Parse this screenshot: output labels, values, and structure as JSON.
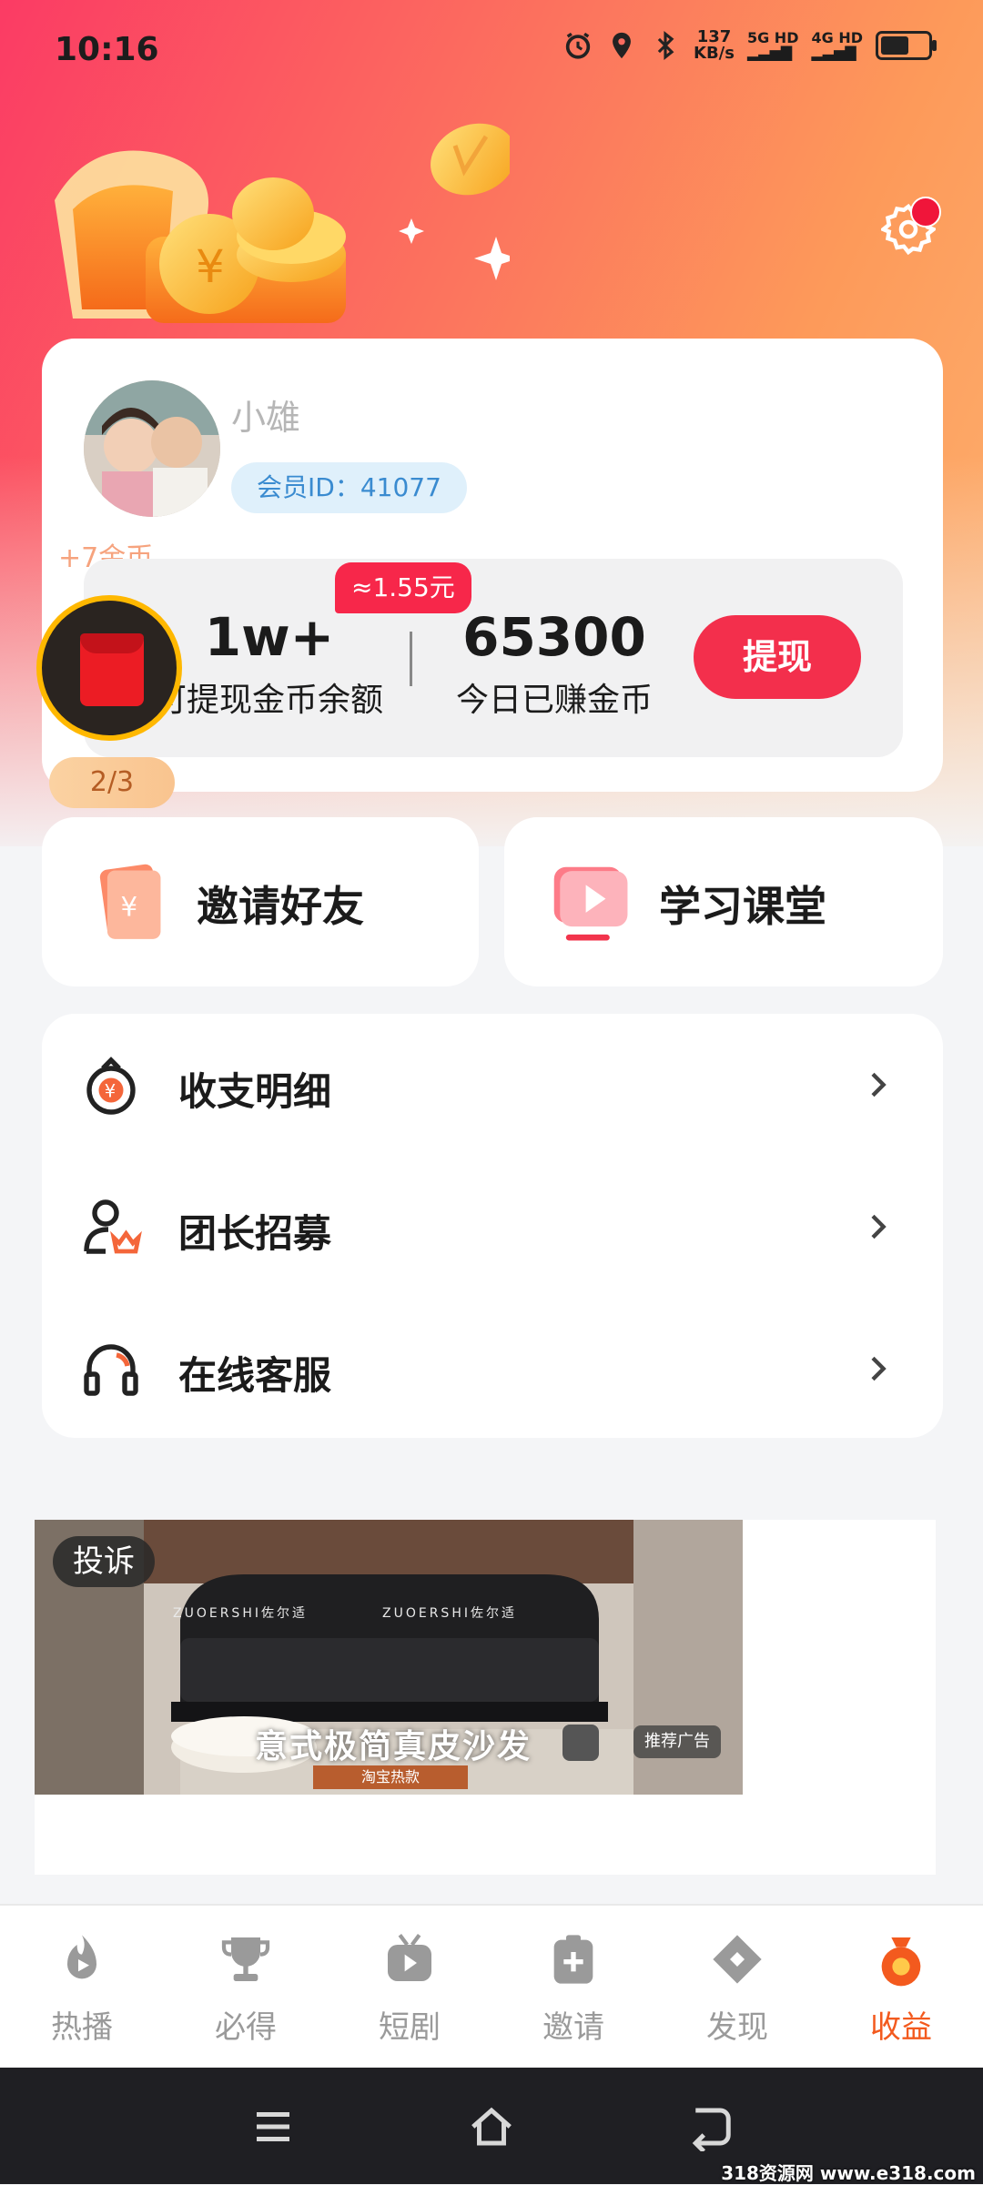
{
  "status_bar": {
    "time": "10:16",
    "net_speed_value": "137",
    "net_speed_unit": "KB/s",
    "sim1": "5G HD",
    "sim2": "4G HD"
  },
  "profile": {
    "username": "小雄",
    "member_id": "会员ID：41077",
    "plus_coins": "+7金币",
    "approx_value": "≈1.55元",
    "balance_value": "1w+",
    "balance_label": "可提现金币余额",
    "today_value": "65300",
    "today_label": "今日已赚金币",
    "withdraw_label": "提现",
    "task_progress": "2/3"
  },
  "quick_actions": [
    {
      "label": "邀请好友"
    },
    {
      "label": "学习课堂"
    }
  ],
  "menu": [
    {
      "label": "收支明细"
    },
    {
      "label": "团长招募"
    },
    {
      "label": "在线客服"
    }
  ],
  "ad": {
    "complain_label": "投诉",
    "caption": "意式极简真皮沙发",
    "sub_caption": "淘宝热款",
    "tag": "推荐广告",
    "brand": "ZUOERSHI佐尔适"
  },
  "bottom_nav": [
    {
      "label": "热播"
    },
    {
      "label": "必得"
    },
    {
      "label": "短剧"
    },
    {
      "label": "邀请"
    },
    {
      "label": "发现"
    },
    {
      "label": "收益",
      "active": true
    }
  ],
  "watermark": "318资源网 www.e318.com",
  "colors": {
    "accent_red": "#f32f4c",
    "active_tab": "#f35a1e",
    "member_pill_bg": "#dff0fb"
  }
}
